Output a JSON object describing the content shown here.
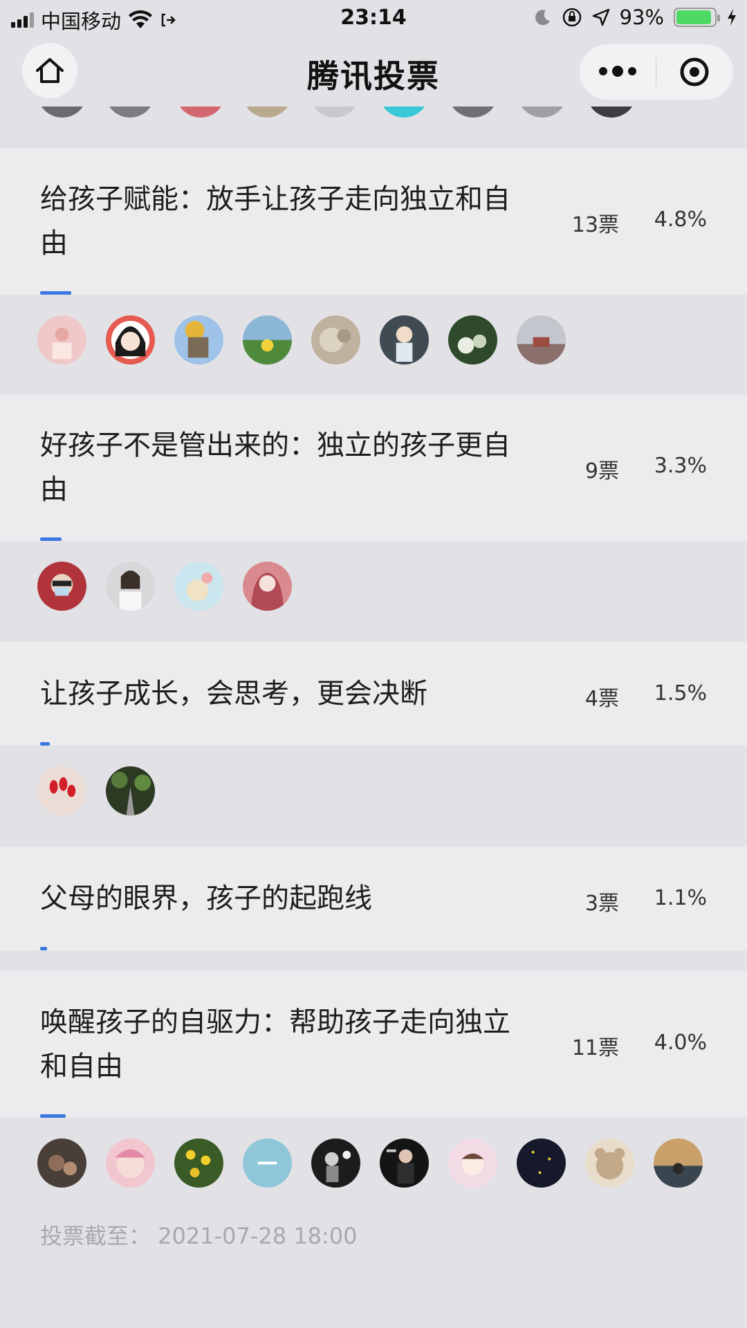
{
  "status_bar": {
    "carrier": "中国移动",
    "time": "23:14",
    "battery_percent": "93%",
    "battery_level": 0.93
  },
  "nav": {
    "title": "腾讯投票"
  },
  "options": [
    {
      "label": "给孩子赋能：放手让孩子走向独立和自由",
      "votes": "13票",
      "percent": "4.8%",
      "share": 0.048,
      "avatar_count": 8
    },
    {
      "label": "好孩子不是管出来的：独立的孩子更自由",
      "votes": "9票",
      "percent": "3.3%",
      "share": 0.033,
      "avatar_count": 4
    },
    {
      "label": "让孩子成长，会思考，更会决断",
      "votes": "4票",
      "percent": "1.5%",
      "share": 0.015,
      "avatar_count": 2
    },
    {
      "label": "父母的眼界，孩子的起跑线",
      "votes": "3票",
      "percent": "1.1%",
      "share": 0.011,
      "avatar_count": 0
    },
    {
      "label": "唤醒孩子的自驱力：帮助孩子走向独立和自由",
      "votes": "11票",
      "percent": "4.0%",
      "share": 0.04,
      "avatar_count": 10
    }
  ],
  "deadline": "投票截至：  2021-07-28 18:00",
  "colors": {
    "accent": "#3a77e0",
    "card_bg": "#ececee",
    "page_bg": "#e2e2e6",
    "battery": "#4cd964"
  }
}
